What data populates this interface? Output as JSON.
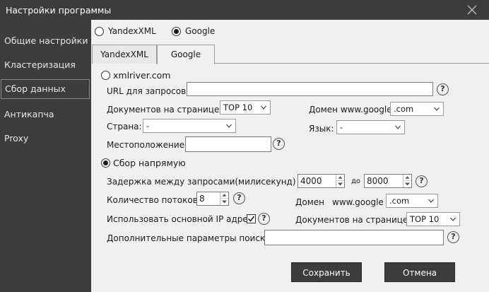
{
  "window": {
    "title": "Настройки программы"
  },
  "sidebar": {
    "items": [
      {
        "label": "Общие настройки"
      },
      {
        "label": "Кластеризация"
      },
      {
        "label": "Сбор данных"
      },
      {
        "label": "Антикапча"
      },
      {
        "label": "Proxy"
      }
    ],
    "active_index": 2
  },
  "engine": {
    "options": [
      "YandexXML",
      "Google"
    ],
    "selected": "Google"
  },
  "tabs": [
    {
      "label": "YandexXML"
    },
    {
      "label": "Google"
    }
  ],
  "active_tab": "Google",
  "xmlriver": {
    "label": "xmlriver.com",
    "url_label": "URL для запросов:",
    "url_value": "",
    "docs_label": "Документов на странице:",
    "docs_value": "TOP 10",
    "domain_label": "Домен www.google",
    "domain_value": ".com",
    "country_label": "Страна:",
    "country_value": "-",
    "lang_label": "Язык:",
    "lang_value": "-",
    "location_label": "Местоположение:",
    "location_value": ""
  },
  "direct": {
    "label": "Сбор напрямую",
    "delay_label": "Задержка между запросами(милисекунд) от",
    "delay_from": "4000",
    "delay_to_label": "до",
    "delay_to": "8000",
    "threads_label": "Количество потоков",
    "threads_value": "8",
    "domain_label_1": "Домен",
    "domain_label_2": "www.google",
    "domain_value": ".com",
    "main_ip_label": "Использовать основной IP адрес",
    "main_ip_checked": true,
    "docs_label": "Документов на странице:",
    "docs_value": "TOP 10",
    "extra_label": "Дополнительные параметры поиска:",
    "extra_value": ""
  },
  "selected_method": "direct",
  "buttons": {
    "save": "Сохранить",
    "cancel": "Отмена"
  },
  "help_glyph": "?",
  "colors": {
    "dark_bg": "#3c3c3c",
    "panel_bg": "#f0f0f0"
  }
}
